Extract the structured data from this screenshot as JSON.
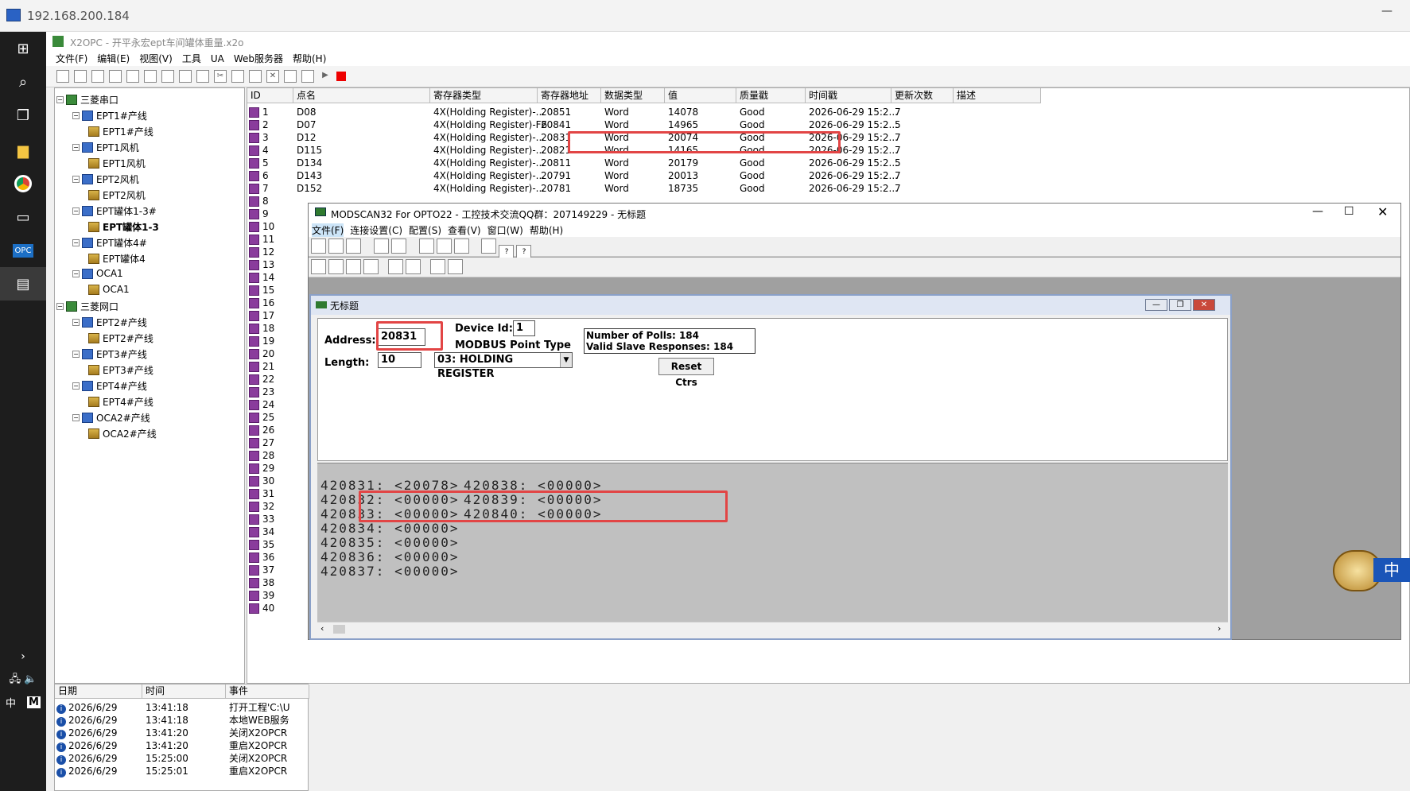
{
  "remote": {
    "title": "192.168.200.184"
  },
  "x2opc": {
    "title": "X2OPC - 开平永宏ept车间罐体重量.x2o",
    "menu": [
      "文件(F)",
      "编辑(E)",
      "视图(V)",
      "工具",
      "UA",
      "Web服务器",
      "帮助(H)"
    ],
    "tree": [
      {
        "label": "三菱串口",
        "level": 0
      },
      {
        "label": "EPT1#产线",
        "level": 1
      },
      {
        "label": "EPT1#产线",
        "level": 2
      },
      {
        "label": "EPT1风机",
        "level": 1
      },
      {
        "label": "EPT1风机",
        "level": 2
      },
      {
        "label": "EPT2风机",
        "level": 1
      },
      {
        "label": "EPT2风机",
        "level": 2
      },
      {
        "label": "EPT罐体1-3#",
        "level": 1
      },
      {
        "label": "EPT罐体1-3",
        "level": 2,
        "bold": true
      },
      {
        "label": "EPT罐体4#",
        "level": 1
      },
      {
        "label": "EPT罐体4",
        "level": 2
      },
      {
        "label": "OCA1",
        "level": 1
      },
      {
        "label": "OCA1",
        "level": 2
      },
      {
        "label": "三菱网口",
        "level": 0
      },
      {
        "label": "EPT2#产线",
        "level": 1
      },
      {
        "label": "EPT2#产线",
        "level": 2
      },
      {
        "label": "EPT3#产线",
        "level": 1
      },
      {
        "label": "EPT3#产线",
        "level": 2
      },
      {
        "label": "EPT4#产线",
        "level": 1
      },
      {
        "label": "EPT4#产线",
        "level": 2
      },
      {
        "label": "OCA2#产线",
        "level": 1
      },
      {
        "label": "OCA2#产线",
        "level": 2
      }
    ],
    "grid_headers": [
      "ID",
      "点名",
      "寄存器类型",
      "寄存器地址",
      "数据类型",
      "值",
      "质量戳",
      "时间戳",
      "更新次数",
      "描述"
    ],
    "grid_rows": [
      [
        "1",
        "D08",
        "4X(Holding Register)-...",
        "20851",
        "Word",
        "14078",
        "Good",
        "2026-06-29 15:2...",
        "7"
      ],
      [
        "2",
        "D07",
        "4X(Holding Register)-F6",
        "20841",
        "Word",
        "14965",
        "Good",
        "2026-06-29 15:2...",
        "5"
      ],
      [
        "3",
        "D12",
        "4X(Holding Register)-...",
        "20831",
        "Word",
        "20074",
        "Good",
        "2026-06-29 15:2...",
        "7"
      ],
      [
        "4",
        "D115",
        "4X(Holding Register)-...",
        "20821",
        "Word",
        "14165",
        "Good",
        "2026-06-29 15:2...",
        "7"
      ],
      [
        "5",
        "D134",
        "4X(Holding Register)-...",
        "20811",
        "Word",
        "20179",
        "Good",
        "2026-06-29 15:2...",
        "5"
      ],
      [
        "6",
        "D143",
        "4X(Holding Register)-...",
        "20791",
        "Word",
        "20013",
        "Good",
        "2026-06-29 15:2...",
        "7"
      ],
      [
        "7",
        "D152",
        "4X(Holding Register)-...",
        "20781",
        "Word",
        "18735",
        "Good",
        "2026-06-29 15:2...",
        "7"
      ]
    ],
    "row_ids_hidden": [
      "8",
      "9",
      "10",
      "11",
      "12",
      "13",
      "14",
      "15",
      "16",
      "17",
      "18",
      "19",
      "20",
      "21",
      "22",
      "23",
      "24",
      "25",
      "26",
      "27",
      "28",
      "29",
      "30",
      "31",
      "32",
      "33",
      "34",
      "35",
      "36",
      "37",
      "38",
      "39",
      "40"
    ],
    "log_headers": [
      "日期",
      "时间",
      "事件"
    ],
    "log_rows": [
      [
        "2026/6/29",
        "13:41:18",
        "打开工程'C:\\U"
      ],
      [
        "2026/6/29",
        "13:41:18",
        "本地WEB服务"
      ],
      [
        "2026/6/29",
        "13:41:20",
        "关闭X2OPCR"
      ],
      [
        "2026/6/29",
        "13:41:20",
        "重启X2OPCR"
      ],
      [
        "2026/6/29",
        "15:25:00",
        "关闭X2OPCR"
      ],
      [
        "2026/6/29",
        "15:25:01",
        "重启X2OPCR"
      ]
    ]
  },
  "modscan": {
    "title": "MODSCAN32 For OPTO22 - 工控技术交流QQ群：207149229 - 无标题",
    "menu": [
      "文件(F)",
      "连接设置(C)",
      "配置(S)",
      "查看(V)",
      "窗口(W)",
      "帮助(H)"
    ],
    "child_title": "无标题",
    "address_label": "Address:",
    "address": "20831",
    "device_id_label": "Device Id:",
    "device_id": "1",
    "point_type_label": "MODBUS Point Type",
    "length_label": "Length:",
    "length": "10",
    "point_type": "03: HOLDING REGISTER",
    "polls": "Number of Polls: 184",
    "responses": "Valid Slave Responses: 184",
    "reset": "Reset Ctrs",
    "registers_left": [
      "420831:  <20078>",
      "420832:  <00000>",
      "420833:  <00000>",
      "420834:  <00000>",
      "420835:  <00000>",
      "420836:  <00000>",
      "420837:  <00000>"
    ],
    "registers_right": [
      "420838:  <00000>",
      "420839:  <00000>",
      "420840:  <00000>"
    ]
  },
  "ime": {
    "label": "中"
  },
  "taskbar": {
    "ime": "中",
    "m": "M"
  }
}
